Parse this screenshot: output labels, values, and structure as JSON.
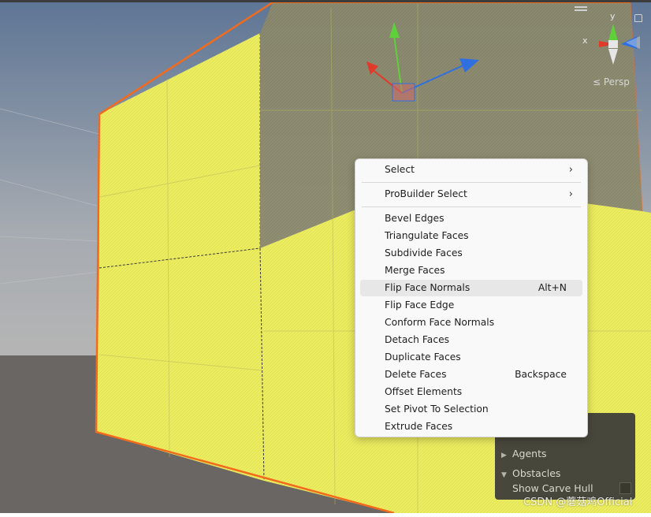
{
  "colors": {
    "sky_top": "#6a7f99",
    "sky_bottom": "#a8adb3",
    "ground": "#6a6663",
    "face_yellow": "#eded60",
    "face_dark": "#8c8a6a",
    "selection_orange": "#f26b1d",
    "axis_x": "#e03a2a",
    "axis_y": "#5ed13a",
    "axis_z": "#2f6fe0"
  },
  "gizmo": {
    "y_label": "y",
    "x_label": "x",
    "persp_label": "≤ Persp",
    "icons": [
      "menu-icon",
      "lock-icon"
    ]
  },
  "context_menu": {
    "items": [
      {
        "label": "Select",
        "shortcut": "",
        "submenu": true
      },
      {
        "label": "ProBuilder Select",
        "shortcut": "",
        "submenu": true
      },
      {
        "label": "Bevel Edges",
        "shortcut": ""
      },
      {
        "label": "Triangulate Faces",
        "shortcut": ""
      },
      {
        "label": "Subdivide Faces",
        "shortcut": ""
      },
      {
        "label": "Merge Faces",
        "shortcut": ""
      },
      {
        "label": "Flip Face Normals",
        "shortcut": "Alt+N",
        "highlighted": true
      },
      {
        "label": "Flip Face Edge",
        "shortcut": ""
      },
      {
        "label": "Conform Face Normals",
        "shortcut": ""
      },
      {
        "label": "Detach Faces",
        "shortcut": ""
      },
      {
        "label": "Duplicate Faces",
        "shortcut": ""
      },
      {
        "label": "Delete Faces",
        "shortcut": "Backspace"
      },
      {
        "label": "Offset Elements",
        "shortcut": ""
      },
      {
        "label": "Set Pivot To Selection",
        "shortcut": ""
      },
      {
        "label": "Extrude Faces",
        "shortcut": ""
      }
    ],
    "submenu_icon": "chevron-right-icon"
  },
  "navigation_overlay": {
    "agents_label": "Agents",
    "obstacles_label": "Obstacles",
    "show_carve_hull_label": "Show Carve Hull",
    "show_carve_hull_checked": false
  },
  "watermark": "CSDN @蘑菇鸡Official"
}
